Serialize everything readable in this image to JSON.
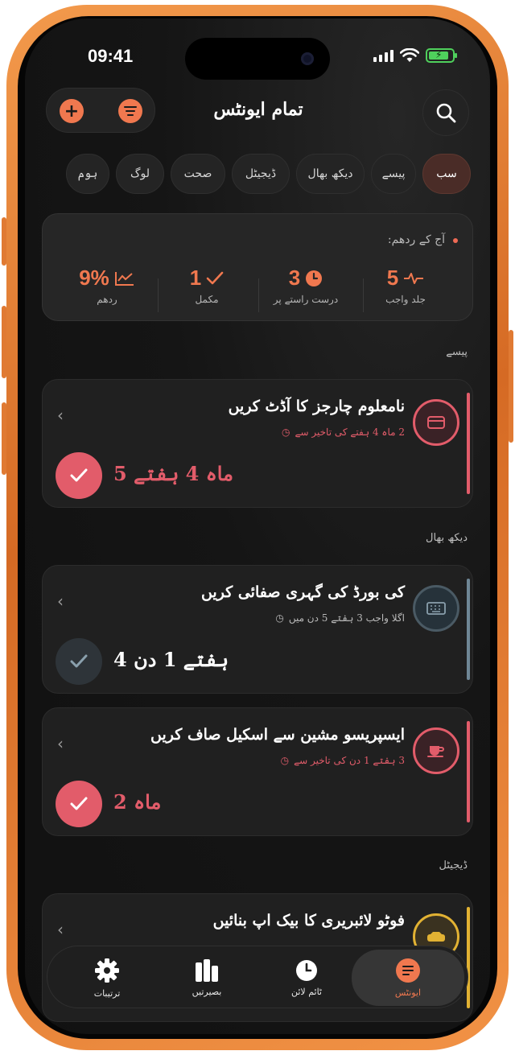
{
  "status_bar": {
    "time": "09:41"
  },
  "header": {
    "title": "تمام ایونٹس"
  },
  "filters": {
    "chips": [
      {
        "label": "سب",
        "active": true
      },
      {
        "label": "پیسے",
        "active": false
      },
      {
        "label": "دیکھ بھال",
        "active": false
      },
      {
        "label": "ڈیجیٹل",
        "active": false
      },
      {
        "label": "صحت",
        "active": false
      },
      {
        "label": "لوگ",
        "active": false
      },
      {
        "label": "ہوم",
        "active": false
      }
    ]
  },
  "rhythm": {
    "title": "آج کے ردھم:",
    "stats": [
      {
        "value": "5",
        "label": "جلد واجب",
        "icon": "pulse-icon"
      },
      {
        "value": "3",
        "label": "درست راستے پر",
        "icon": "clock-icon"
      },
      {
        "value": "1",
        "label": "مکمل",
        "icon": "check-icon"
      },
      {
        "value": "9%",
        "label": "ردھم",
        "icon": "chart-icon"
      }
    ]
  },
  "sections": [
    {
      "label": "پیسے",
      "cards": [
        {
          "title": "نامعلوم چارجز کا آڈٹ کریں",
          "subtitle": "2 ماہ 4 ہفتے کی تاخیر سے",
          "value": "5 ماہ 4 ہفتے",
          "done": true,
          "icon": "card-icon",
          "accent": "#e25c6a"
        }
      ]
    },
    {
      "label": "دیکھ بھال",
      "cards": [
        {
          "title": "کی بورڈ کی گہری صفائی کریں",
          "subtitle": "اگلا واجب 3 ہفتے 5 دن میں",
          "value": "4 ہفتے 1 دن",
          "done": false,
          "icon": "keyboard-icon",
          "accent": "#6f8796"
        },
        {
          "title": "ایسپریسو مشین سے اسکیل صاف کریں",
          "subtitle": "3 ہفتے 1 دن کی تاخیر سے",
          "value": "2 ماہ",
          "done": true,
          "icon": "coffee-icon",
          "accent": "#e25c6a"
        }
      ]
    },
    {
      "label": "ڈیجیٹل",
      "cards": [
        {
          "title": "فوٹو لائبریری کا بیک اپ بنائیں",
          "icon": "drive-icon",
          "accent": "#e2b233"
        }
      ]
    }
  ],
  "tabbar": {
    "tabs": [
      {
        "label": "ایونٹس",
        "icon": "list-icon",
        "active": true
      },
      {
        "label": "ٹائم لائن",
        "icon": "clock-icon",
        "active": false
      },
      {
        "label": "بصیرتیں",
        "icon": "bars-icon",
        "active": false
      },
      {
        "label": "ترتیبات",
        "icon": "gear-icon",
        "active": false
      }
    ]
  },
  "colors": {
    "accent": "#f0784f",
    "overdue": "#e25c6a",
    "warning": "#e2b233"
  }
}
